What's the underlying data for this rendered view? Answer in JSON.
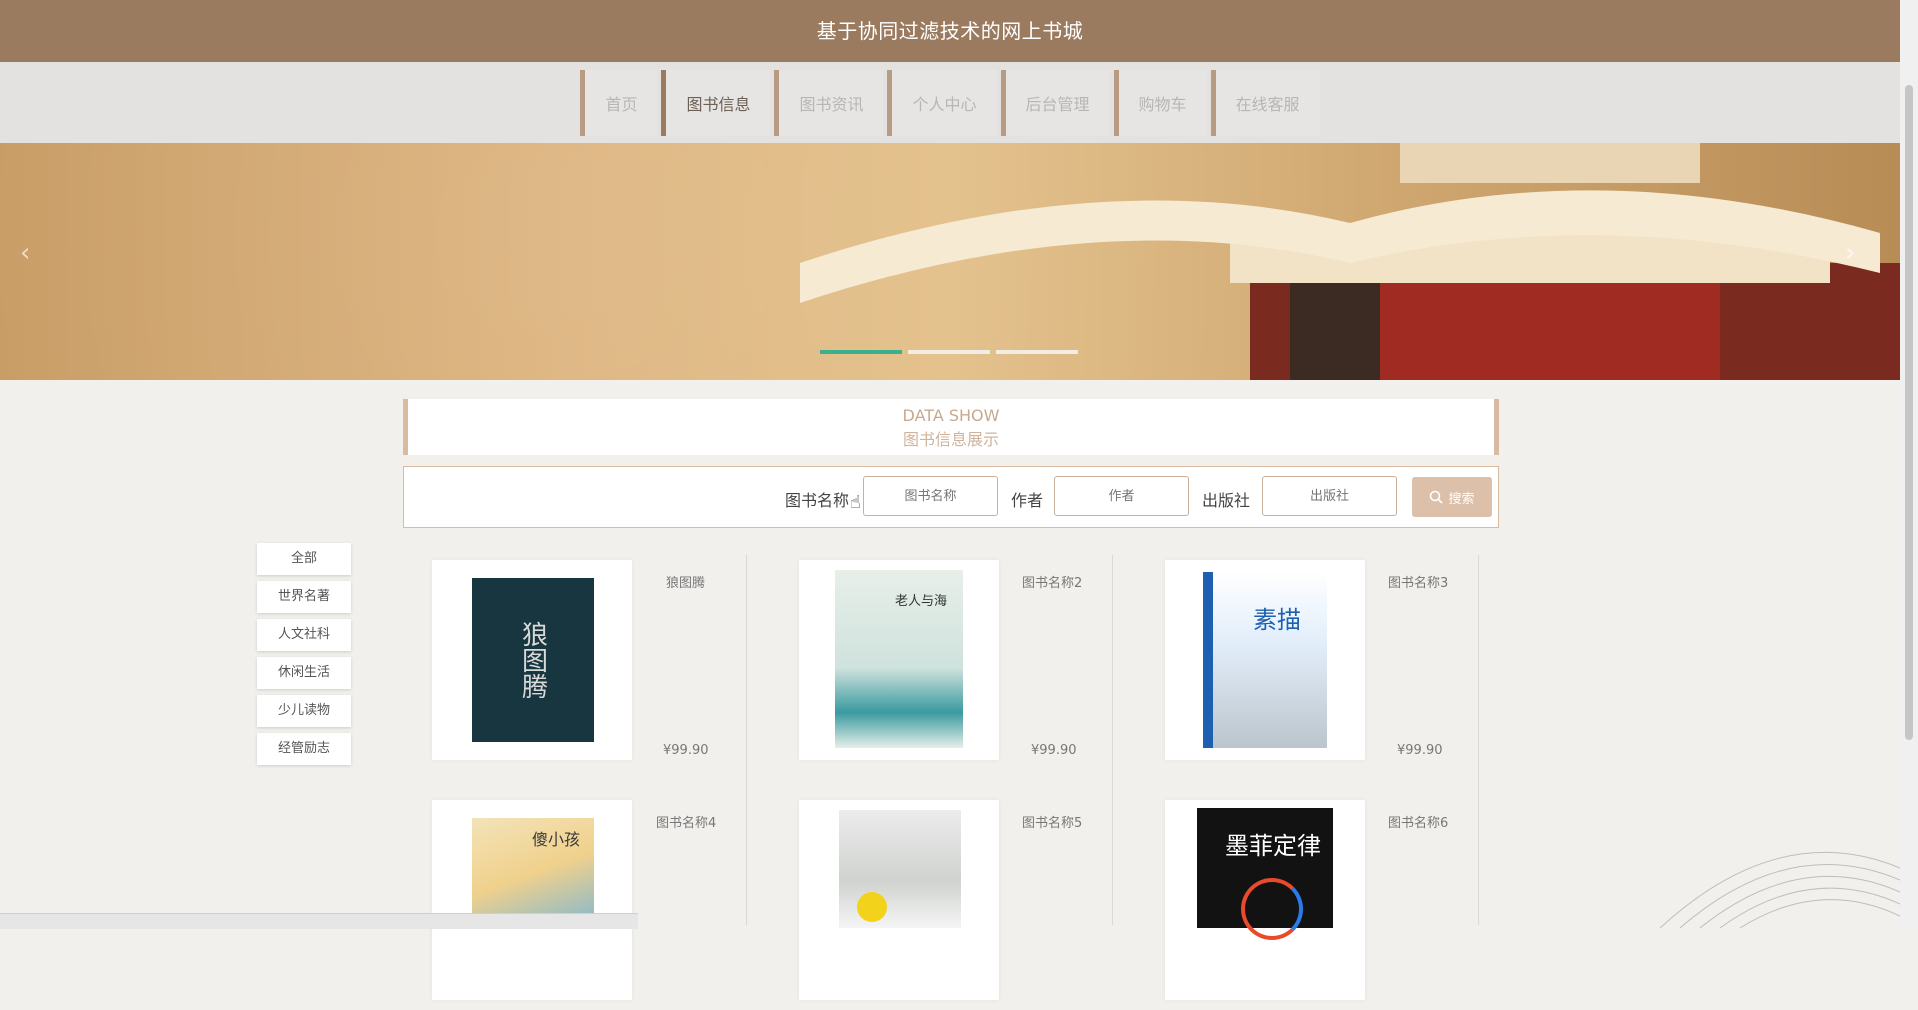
{
  "header": {
    "title": "基于协同过滤技术的网上书城"
  },
  "nav": [
    {
      "label": "首页",
      "active": false
    },
    {
      "label": "图书信息",
      "active": true
    },
    {
      "label": "图书资讯",
      "active": false
    },
    {
      "label": "个人中心",
      "active": false
    },
    {
      "label": "后台管理",
      "active": false
    },
    {
      "label": "购物车",
      "active": false
    },
    {
      "label": "在线客服",
      "active": false
    }
  ],
  "banner": {
    "slides": 3,
    "active_slide": 1
  },
  "section": {
    "title_en": "DATA SHOW",
    "title_zh": "图书信息展示"
  },
  "search": {
    "name_label": "图书名称",
    "name_placeholder": "图书名称",
    "author_label": "作者",
    "author_placeholder": "作者",
    "publisher_label": "出版社",
    "publisher_placeholder": "出版社",
    "button_label": "搜索",
    "button_icon": "search-icon"
  },
  "categories": [
    "全部",
    "世界名著",
    "人文社科",
    "休闲生活",
    "少儿读物",
    "经管励志"
  ],
  "products": [
    {
      "name": "狼图腾",
      "price": "¥99.90",
      "cover_text": "狼图腾"
    },
    {
      "name": "图书名称2",
      "price": "¥99.90",
      "cover_text": "老人与海"
    },
    {
      "name": "图书名称3",
      "price": "¥99.90",
      "cover_text": "素描"
    },
    {
      "name": "图书名称4",
      "price": "",
      "cover_text": "傻小孩"
    },
    {
      "name": "图书名称5",
      "price": "",
      "cover_text": ""
    },
    {
      "name": "图书名称6",
      "price": "",
      "cover_text": "墨菲定律"
    }
  ],
  "colors": {
    "header": "#9b7b60",
    "accent": "#d8bba0",
    "active_dot": "#3bb08a"
  }
}
